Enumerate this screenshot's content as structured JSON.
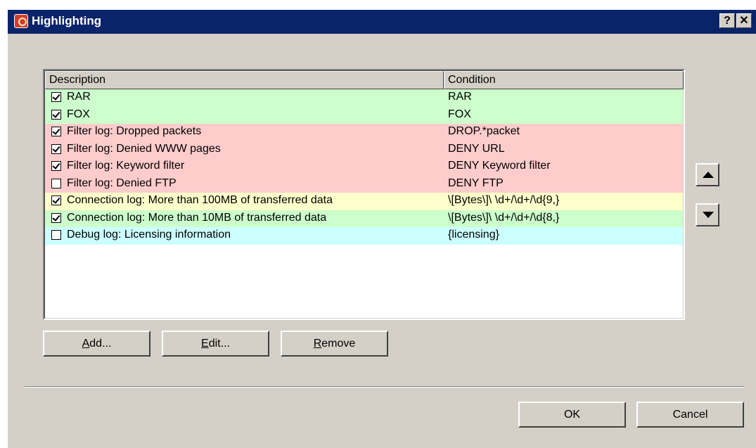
{
  "window": {
    "title": "Highlighting",
    "help_label": "?",
    "close_label": "✕"
  },
  "columns": {
    "description": "Description",
    "condition": "Condition"
  },
  "rows": [
    {
      "checked": true,
      "description": "RAR",
      "condition": "RAR",
      "color": "#ccffcc"
    },
    {
      "checked": true,
      "description": "FOX",
      "condition": "FOX",
      "color": "#ccffcc"
    },
    {
      "checked": true,
      "description": "Filter log: Dropped packets",
      "condition": "DROP.*packet",
      "color": "#ffcccc"
    },
    {
      "checked": true,
      "description": "Filter log: Denied WWW pages",
      "condition": "DENY URL",
      "color": "#ffcccc"
    },
    {
      "checked": true,
      "description": "Filter log: Keyword filter",
      "condition": "DENY Keyword filter",
      "color": "#ffcccc"
    },
    {
      "checked": false,
      "description": "Filter log: Denied FTP",
      "condition": "DENY FTP",
      "color": "#ffcccc"
    },
    {
      "checked": true,
      "description": "Connection log: More than 100MB of transferred data",
      "condition": "\\[Bytes\\]\\ \\d+/\\d+/\\d{9,}",
      "color": "#ffffcc"
    },
    {
      "checked": true,
      "description": "Connection log: More than 10MB of transferred data",
      "condition": "\\[Bytes\\]\\ \\d+/\\d+/\\d{8,}",
      "color": "#ccffcc"
    },
    {
      "checked": false,
      "description": "Debug log: Licensing information",
      "condition": "{licensing}",
      "color": "#ccffff"
    }
  ],
  "buttons": {
    "add": {
      "mnemonic": "A",
      "rest": "dd..."
    },
    "edit": {
      "mnemonic": "E",
      "rest": "dit..."
    },
    "remove": {
      "mnemonic": "R",
      "rest": "emove"
    },
    "ok": "OK",
    "cancel": "Cancel"
  },
  "icons": {
    "move_up": "up-triangle-icon",
    "move_down": "down-triangle-icon",
    "app": "highlighting-app-icon"
  }
}
